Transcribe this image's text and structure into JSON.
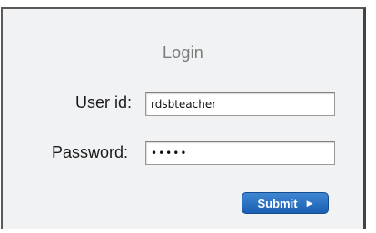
{
  "form": {
    "title": "Login",
    "user_label": "User id:",
    "user_value": "rdsbteacher",
    "password_label": "Password:",
    "password_value": "•••••",
    "submit_label": "Submit",
    "submit_icon": "arrow-right-icon",
    "accent_color": "#1f66bd"
  }
}
